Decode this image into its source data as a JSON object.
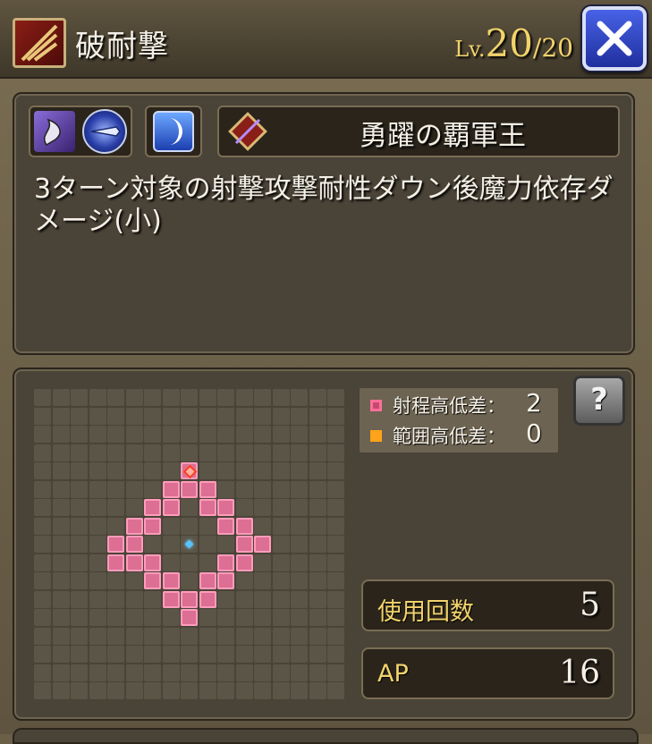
{
  "header": {
    "skill_name": "破耐撃",
    "level_label": "Lv.",
    "level_current": "20",
    "level_separator": "/",
    "level_max": "20"
  },
  "info": {
    "equipment_name": "勇躍の覇軍王",
    "description": "3ターン対象の射撃攻撃耐性ダウン後魔力依存ダメージ(小)"
  },
  "legend": {
    "range_height_label": "射程高低差：",
    "range_height_value": "2",
    "area_height_label": "範囲高低差：",
    "area_height_value": "0"
  },
  "help_button": {
    "glyph": "?"
  },
  "stats": {
    "uses_label": "使用回数",
    "uses_value": "5",
    "ap_label": "AP",
    "ap_value": "16"
  },
  "range_grid": {
    "size": 17,
    "origin": [
      8,
      8
    ],
    "target": [
      8,
      4
    ],
    "range_cells": [
      [
        8,
        5
      ],
      [
        9,
        5
      ],
      [
        7,
        6
      ],
      [
        8,
        4
      ],
      [
        7,
        5
      ],
      [
        6,
        6
      ],
      [
        6,
        7
      ],
      [
        5,
        7
      ],
      [
        4,
        8
      ],
      [
        5,
        8
      ],
      [
        9,
        6
      ],
      [
        10,
        6
      ],
      [
        10,
        7
      ],
      [
        11,
        7
      ],
      [
        11,
        8
      ],
      [
        12,
        8
      ],
      [
        4,
        9
      ],
      [
        5,
        9
      ],
      [
        6,
        9
      ],
      [
        6,
        10
      ],
      [
        7,
        10
      ],
      [
        7,
        11
      ],
      [
        8,
        11
      ],
      [
        9,
        11
      ],
      [
        8,
        12
      ],
      [
        11,
        9
      ],
      [
        10,
        9
      ],
      [
        10,
        10
      ],
      [
        9,
        10
      ]
    ]
  },
  "colors": {
    "range_cell": "#dc6f93",
    "area_swatch": "#ffa31a",
    "label_gold": "#f2d36b",
    "close_button": "#3348c8"
  },
  "icons": {
    "skill": "slash-icon",
    "element": "dark-element-icon",
    "weapon": "weapon-type-icon",
    "attribute": "crescent-moon-icon",
    "equipment": "bow-icon",
    "close": "close-icon",
    "help": "help-book-icon"
  }
}
